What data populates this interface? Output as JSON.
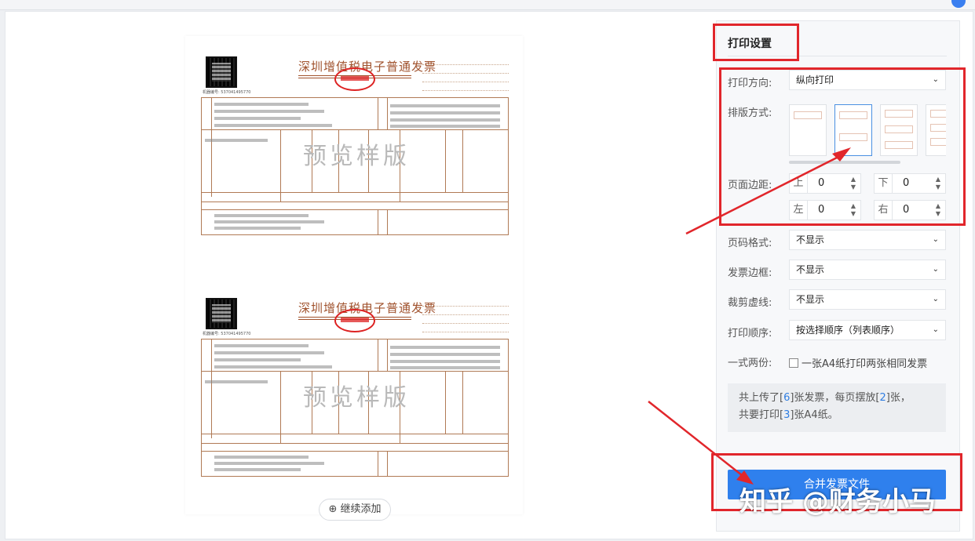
{
  "colors": {
    "accent": "#2f80ed",
    "annotation_red": "#e1262b",
    "invoice_brown": "#a0522d"
  },
  "preview": {
    "invoice_title": "深圳增值税电子普通发票",
    "watermark": "预览样版",
    "add_button": "继续添加",
    "add_icon": "plus-circle-icon"
  },
  "panel": {
    "title": "打印设置",
    "orientation": {
      "label": "打印方向:",
      "value": "纵向打印"
    },
    "layout": {
      "label": "排版方式:"
    },
    "margins": {
      "label": "页面边距:",
      "top": {
        "label": "上",
        "value": "0"
      },
      "bottom": {
        "label": "下",
        "value": "0"
      },
      "left": {
        "label": "左",
        "value": "0"
      },
      "right": {
        "label": "右",
        "value": "0"
      }
    },
    "page_number": {
      "label": "页码格式:",
      "value": "不显示"
    },
    "border": {
      "label": "发票边框:",
      "value": "不显示"
    },
    "cut_line": {
      "label": "裁剪虚线:",
      "value": "不显示"
    },
    "order": {
      "label": "打印顺序:",
      "value": "按选择顺序（列表顺序）"
    },
    "duplicate": {
      "label": "一式两份:",
      "option": "一张A4纸打印两张相同发票"
    },
    "summary": {
      "p1": "共上传了[",
      "uploaded": "6",
      "p2": "]张发票，每页摆放[",
      "per_page": "2",
      "p3": "]张，",
      "p4": "共要打印[",
      "sheets": "3",
      "p5": "]张A4纸。"
    },
    "merge_button": "合并发票文件"
  },
  "overlay_text": "知乎 @财务小马"
}
